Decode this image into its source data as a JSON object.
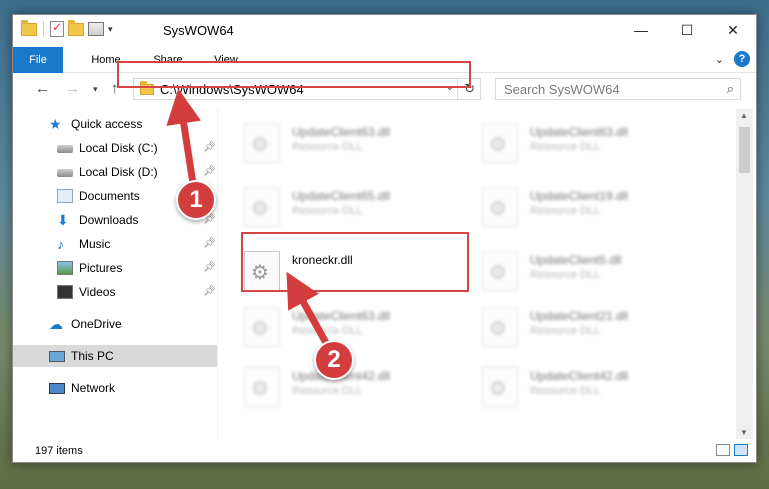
{
  "window": {
    "title": "SysWOW64",
    "minimize_glyph": "—",
    "maximize_glyph": "☐",
    "close_glyph": "✕"
  },
  "ribbon": {
    "tabs": [
      "File",
      "Home",
      "Share",
      "View"
    ],
    "help_glyph": "?"
  },
  "navigation": {
    "address": "C:\\Windows\\SysWOW64",
    "search_placeholder": "Search SysWOW64"
  },
  "sidebar": {
    "items": [
      {
        "label": "Quick access",
        "icon": "star-icon"
      },
      {
        "label": "Local Disk (C:)",
        "icon": "drive-icon",
        "pinned": true
      },
      {
        "label": "Local Disk (D:)",
        "icon": "drive-icon",
        "pinned": true
      },
      {
        "label": "Documents",
        "icon": "documents-icon",
        "pinned": true
      },
      {
        "label": "Downloads",
        "icon": "download-icon",
        "pinned": true
      },
      {
        "label": "Music",
        "icon": "music-icon",
        "pinned": true
      },
      {
        "label": "Pictures",
        "icon": "pictures-icon",
        "pinned": true
      },
      {
        "label": "Videos",
        "icon": "videos-icon",
        "pinned": true
      },
      {
        "label": "OneDrive",
        "icon": "cloud-icon"
      },
      {
        "label": "This PC",
        "icon": "computer-icon",
        "selected": true
      },
      {
        "label": "Network",
        "icon": "network-icon"
      }
    ]
  },
  "files": {
    "highlighted": {
      "name": "kroneckr.dll"
    },
    "blurred": [
      {
        "name": "UpdateClient63.dll",
        "type": "Resource DLL"
      },
      {
        "name": "UpdateClient63.dll",
        "type": "Resource DLL"
      },
      {
        "name": "UpdateClient65.dll",
        "type": "Resource DLL"
      },
      {
        "name": "UpdateClient19.dll",
        "type": "Resource DLL"
      },
      {
        "name": "UpdateClient5.dll",
        "type": "Resource DLL"
      },
      {
        "name": "UpdateClient63.dll",
        "type": "Resource DLL"
      },
      {
        "name": "UpdateClient21.dll",
        "type": "Resource DLL"
      },
      {
        "name": "UpdateClient42.dll",
        "type": "Resource DLL"
      },
      {
        "name": "UpdateClient42.dll",
        "type": "Resource DLL"
      }
    ]
  },
  "status": {
    "item_count": "197 items"
  },
  "callouts": [
    "1",
    "2"
  ],
  "colors": {
    "accent": "#1979ca",
    "highlight": "#d64545",
    "callout": "#d43d3d"
  }
}
